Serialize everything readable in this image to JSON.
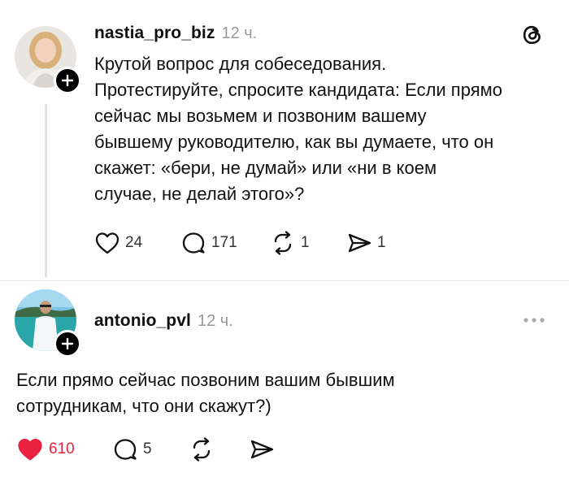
{
  "post": {
    "username": "nastia_pro_biz",
    "time": "12 ч.",
    "text_lines": [
      "Крутой вопрос для собеседования.",
      "Протестируйте, спросите кандидата: Если прямо",
      "сейчас мы возьмем и позвоним вашему",
      "бывшему руководителю, как вы думаете, что он",
      "скажет: «бери, не думай» или «ни в коем",
      "случае, не делай этого»?"
    ],
    "likes": "24",
    "replies": "171",
    "reposts": "1",
    "shares": "1"
  },
  "reply": {
    "username": "antonio_pvl",
    "time": "12 ч.",
    "text_lines": [
      "Если прямо сейчас позвоним вашим бывшим",
      "сотрудникам, что они скажут?)"
    ],
    "likes": "610",
    "replies": "5"
  },
  "colors": {
    "like_active": "#e8223f",
    "muted": "#999999"
  }
}
